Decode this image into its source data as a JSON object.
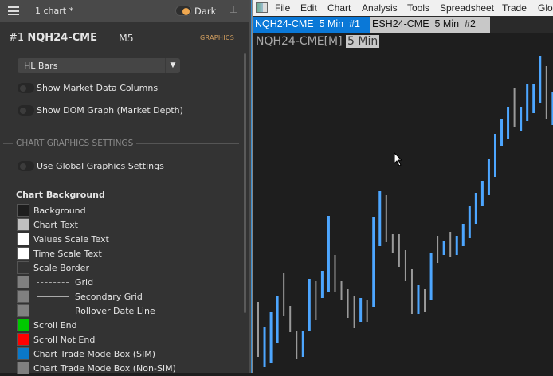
{
  "panel": {
    "title": "1 chart *",
    "theme_label": "Dark",
    "chart_number": "#1",
    "symbol": "NQH24-CME",
    "timeframe": "M5",
    "graphics_link": "GRAPHICS",
    "chart_type": "HL Bars",
    "toggles": [
      {
        "label": "Show Market Data Columns",
        "on": false
      },
      {
        "label": "Show DOM Graph (Market Depth)",
        "on": false
      }
    ],
    "section_title": "CHART GRAPHICS SETTINGS",
    "global_toggle": {
      "label": "Use Global Graphics Settings",
      "on": false
    },
    "background_heading": "Chart Background",
    "colors": [
      {
        "label": "Background",
        "color": "#1e1e1e"
      },
      {
        "label": "Chart Text",
        "color": "#c0c0c0"
      },
      {
        "label": "Values Scale Text",
        "color": "#ffffff"
      },
      {
        "label": "Time Scale Text",
        "color": "#ffffff"
      },
      {
        "label": "Scale Border",
        "color": "#333333"
      },
      {
        "label": "Grid",
        "color": "#808080",
        "line": "dashed"
      },
      {
        "label": "Secondary Grid",
        "color": "#808080",
        "line": "solid"
      },
      {
        "label": "Rollover Date Line",
        "color": "#808080",
        "line": "dashed"
      },
      {
        "label": "Scroll End",
        "color": "#00c800"
      },
      {
        "label": "Scroll Not End",
        "color": "#ff0000"
      },
      {
        "label": "Chart Trade Mode Box (SIM)",
        "color": "#0a78c8"
      },
      {
        "label": "Chart Trade Mode Box (Non-SIM)",
        "color": "#808080"
      }
    ]
  },
  "menu": [
    "File",
    "Edit",
    "Chart",
    "Analysis",
    "Tools",
    "Spreadsheet",
    "Trade",
    "Glob"
  ],
  "tabs": [
    {
      "label": "NQH24-CME  5 Min  #1",
      "active": true
    },
    {
      "label": "ESH24-CME  5 Min  #2",
      "active": false
    }
  ],
  "chart": {
    "symbol_label": "NQH24-CME[M]",
    "interval_label": "5 Min",
    "up_color": "#4da6ff",
    "down_color": "#9a9a9a"
  },
  "chart_data": {
    "type": "hl-bars",
    "bars": [
      [
        89,
        20,
        "d"
      ],
      [
        58,
        7,
        "u"
      ],
      [
        76,
        12,
        "u"
      ],
      [
        97,
        38,
        "u"
      ],
      [
        125,
        71,
        "d"
      ],
      [
        84,
        51,
        "d"
      ],
      [
        53,
        17,
        "d"
      ],
      [
        53,
        20,
        "u"
      ],
      [
        118,
        53,
        "u"
      ],
      [
        115,
        66,
        "d"
      ],
      [
        128,
        94,
        "u"
      ],
      [
        197,
        102,
        "u"
      ],
      [
        148,
        102,
        "d"
      ],
      [
        115,
        92,
        "d"
      ],
      [
        105,
        69,
        "d"
      ],
      [
        97,
        56,
        "d"
      ],
      [
        94,
        64,
        "u"
      ],
      [
        92,
        64,
        "d"
      ],
      [
        195,
        82,
        "u"
      ],
      [
        228,
        159,
        "u"
      ],
      [
        223,
        164,
        "d"
      ],
      [
        174,
        151,
        "d"
      ],
      [
        174,
        133,
        "d"
      ],
      [
        154,
        115,
        "d"
      ],
      [
        130,
        74,
        "d"
      ],
      [
        110,
        74,
        "u"
      ],
      [
        105,
        76,
        "d"
      ],
      [
        151,
        92,
        "u"
      ],
      [
        172,
        138,
        "d"
      ],
      [
        166,
        148,
        "u"
      ],
      [
        177,
        146,
        "d"
      ],
      [
        172,
        148,
        "u"
      ],
      [
        187,
        159,
        "u"
      ],
      [
        210,
        169,
        "u"
      ],
      [
        226,
        187,
        "u"
      ],
      [
        241,
        210,
        "u"
      ],
      [
        269,
        223,
        "u"
      ],
      [
        300,
        246,
        "u"
      ],
      [
        318,
        285,
        "u"
      ],
      [
        334,
        293,
        "u"
      ],
      [
        357,
        308,
        "d"
      ],
      [
        334,
        303,
        "u"
      ],
      [
        362,
        316,
        "u"
      ],
      [
        362,
        326,
        "u"
      ],
      [
        398,
        339,
        "u"
      ],
      [
        385,
        318,
        "d"
      ],
      [
        352,
        311,
        "u"
      ]
    ]
  }
}
